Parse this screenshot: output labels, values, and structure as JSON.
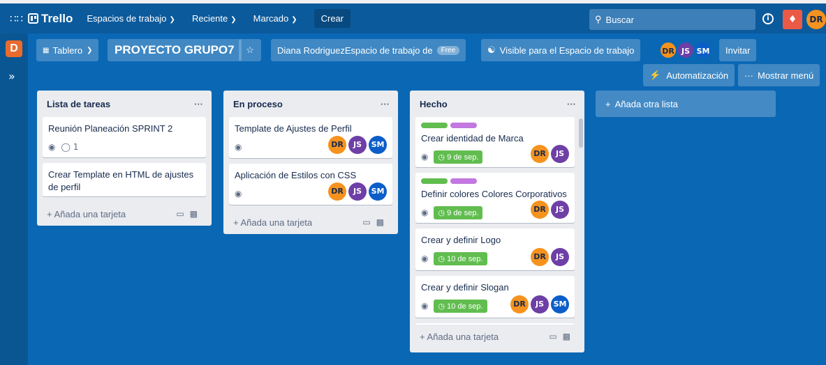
{
  "topbar": {
    "logo": "Trello",
    "nav": [
      {
        "label": "Espacios de trabajo"
      },
      {
        "label": "Reciente"
      },
      {
        "label": "Marcado"
      }
    ],
    "create": "Crear",
    "search_placeholder": "Buscar",
    "user_initials": "DR"
  },
  "sidebar": {
    "workspace_letter": "D"
  },
  "board": {
    "view": "Tablero",
    "title": "PROYECTO GRUPO7",
    "workspace": "Diana RodriguezEspacio de trabajo de",
    "plan": "Free",
    "visibility": "Visible para el Espacio de trabajo",
    "invite": "Invitar",
    "automation": "Automatización",
    "show_menu": "Mostrar menú",
    "members": [
      "DR",
      "JS",
      "SM"
    ]
  },
  "colors": {
    "label_green": "#61bd4f",
    "label_purple": "#c377e0"
  },
  "lists": [
    {
      "name": "Lista de tareas",
      "cards": [
        {
          "title": "Reunión Planeación SPRINT 2",
          "comments": "1"
        },
        {
          "title": "Crear Template en HTML de ajustes de perfil"
        }
      ],
      "add_card": "Añada una tarjeta"
    },
    {
      "name": "En proceso",
      "cards": [
        {
          "title": "Template de Ajustes de Perfil",
          "members": [
            "DR",
            "JS",
            "SM"
          ]
        },
        {
          "title": "Aplicación de Estilos con CSS",
          "members": [
            "DR",
            "JS",
            "SM"
          ]
        }
      ],
      "add_card": "Añada una tarjeta"
    },
    {
      "name": "Hecho",
      "cards": [
        {
          "title": "Crear identidad de Marca",
          "due": "9 de sep.",
          "members": [
            "DR",
            "JS"
          ]
        },
        {
          "title": "Definir colores Colores Corporativos",
          "due": "9 de sep.",
          "members": [
            "DR",
            "JS"
          ]
        },
        {
          "title": "Crear y definir Logo",
          "due": "10 de sep.",
          "members": [
            "DR",
            "JS"
          ]
        },
        {
          "title": "Crear y definir Slogan",
          "due": "10 de sep.",
          "members": [
            "DR",
            "JS",
            "SM"
          ]
        }
      ],
      "add_card": "Añada una tarjeta"
    }
  ],
  "add_list": "Añada otra lista"
}
